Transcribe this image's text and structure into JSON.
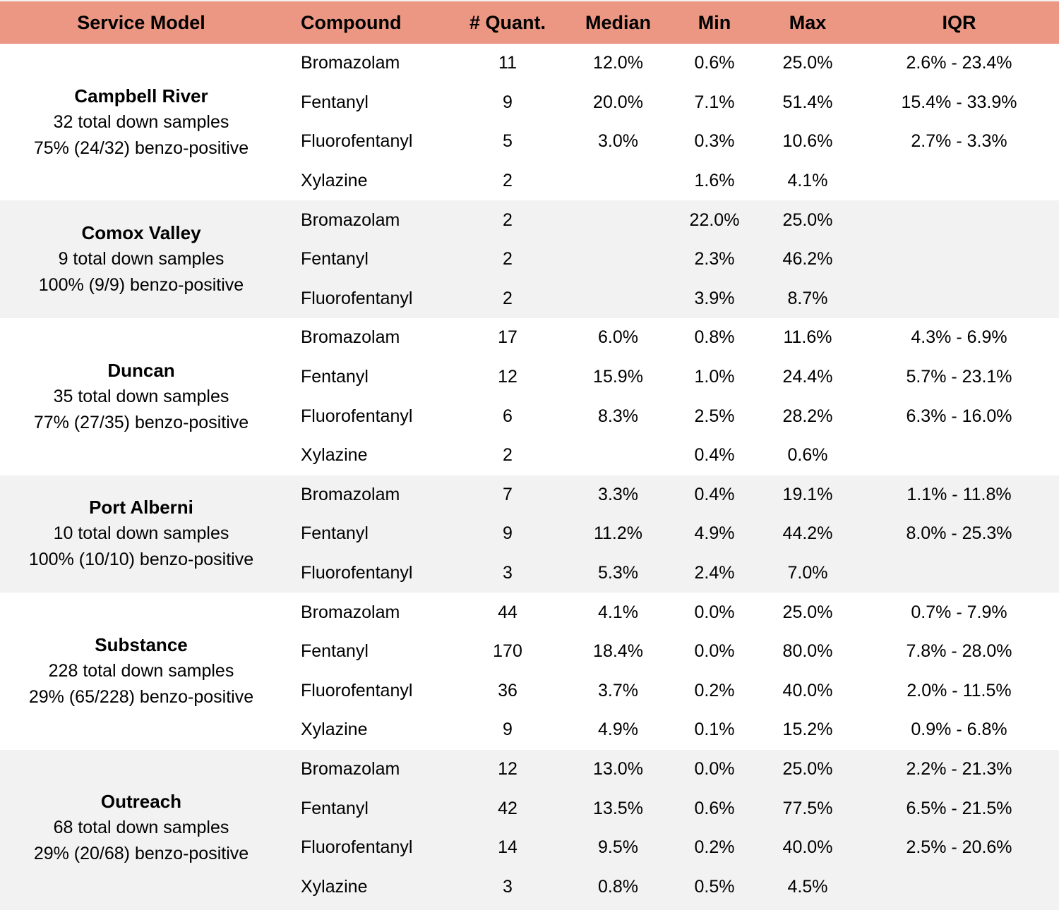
{
  "table": {
    "headers": [
      "Service Model",
      "Compound",
      "# Quant.",
      "Median",
      "Min",
      "Max",
      "IQR"
    ],
    "colors": {
      "header_bg": "#eb9783",
      "row_white": "#ffffff",
      "row_gray": "#f2f2f2"
    },
    "groups": [
      {
        "name": "Campbell River",
        "total": "32 total down samples",
        "benzo": "75% (24/32) benzo-positive",
        "rows": [
          {
            "compound": "Bromazolam",
            "quant": "11",
            "median": "12.0%",
            "min": "0.6%",
            "max": "25.0%",
            "iqr": "2.6% - 23.4%"
          },
          {
            "compound": "Fentanyl",
            "quant": "9",
            "median": "20.0%",
            "min": "7.1%",
            "max": "51.4%",
            "iqr": "15.4% - 33.9%"
          },
          {
            "compound": "Fluorofentanyl",
            "quant": "5",
            "median": "3.0%",
            "min": "0.3%",
            "max": "10.6%",
            "iqr": "2.7% - 3.3%"
          },
          {
            "compound": "Xylazine",
            "quant": "2",
            "median": "",
            "min": "1.6%",
            "max": "4.1%",
            "iqr": ""
          }
        ]
      },
      {
        "name": "Comox Valley",
        "total": "9 total down samples",
        "benzo": "100% (9/9) benzo-positive",
        "rows": [
          {
            "compound": "Bromazolam",
            "quant": "2",
            "median": "",
            "min": "22.0%",
            "max": "25.0%",
            "iqr": ""
          },
          {
            "compound": "Fentanyl",
            "quant": "2",
            "median": "",
            "min": "2.3%",
            "max": "46.2%",
            "iqr": ""
          },
          {
            "compound": "Fluorofentanyl",
            "quant": "2",
            "median": "",
            "min": "3.9%",
            "max": "8.7%",
            "iqr": ""
          }
        ]
      },
      {
        "name": "Duncan",
        "total": "35 total down samples",
        "benzo": "77% (27/35) benzo-positive",
        "rows": [
          {
            "compound": "Bromazolam",
            "quant": "17",
            "median": "6.0%",
            "min": "0.8%",
            "max": "11.6%",
            "iqr": "4.3% - 6.9%"
          },
          {
            "compound": "Fentanyl",
            "quant": "12",
            "median": "15.9%",
            "min": "1.0%",
            "max": "24.4%",
            "iqr": "5.7% - 23.1%"
          },
          {
            "compound": "Fluorofentanyl",
            "quant": "6",
            "median": "8.3%",
            "min": "2.5%",
            "max": "28.2%",
            "iqr": "6.3% - 16.0%"
          },
          {
            "compound": "Xylazine",
            "quant": "2",
            "median": "",
            "min": "0.4%",
            "max": "0.6%",
            "iqr": ""
          }
        ]
      },
      {
        "name": "Port Alberni",
        "total": "10 total down samples",
        "benzo": "100% (10/10) benzo-positive",
        "rows": [
          {
            "compound": "Bromazolam",
            "quant": "7",
            "median": "3.3%",
            "min": "0.4%",
            "max": "19.1%",
            "iqr": "1.1% - 11.8%"
          },
          {
            "compound": "Fentanyl",
            "quant": "9",
            "median": "11.2%",
            "min": "4.9%",
            "max": "44.2%",
            "iqr": "8.0% - 25.3%"
          },
          {
            "compound": "Fluorofentanyl",
            "quant": "3",
            "median": "5.3%",
            "min": "2.4%",
            "max": "7.0%",
            "iqr": ""
          }
        ]
      },
      {
        "name": "Substance",
        "total": "228 total down samples",
        "benzo": "29% (65/228) benzo-positive",
        "rows": [
          {
            "compound": "Bromazolam",
            "quant": "44",
            "median": "4.1%",
            "min": "0.0%",
            "max": "25.0%",
            "iqr": "0.7% - 7.9%"
          },
          {
            "compound": "Fentanyl",
            "quant": "170",
            "median": "18.4%",
            "min": "0.0%",
            "max": "80.0%",
            "iqr": "7.8% - 28.0%"
          },
          {
            "compound": "Fluorofentanyl",
            "quant": "36",
            "median": "3.7%",
            "min": "0.2%",
            "max": "40.0%",
            "iqr": "2.0% - 11.5%"
          },
          {
            "compound": "Xylazine",
            "quant": "9",
            "median": "4.9%",
            "min": "0.1%",
            "max": "15.2%",
            "iqr": "0.9% - 6.8%"
          }
        ]
      },
      {
        "name": "Outreach",
        "total": "68 total down samples",
        "benzo": "29% (20/68) benzo-positive",
        "rows": [
          {
            "compound": "Bromazolam",
            "quant": "12",
            "median": "13.0%",
            "min": "0.0%",
            "max": "25.0%",
            "iqr": "2.2% - 21.3%"
          },
          {
            "compound": "Fentanyl",
            "quant": "42",
            "median": "13.5%",
            "min": "0.6%",
            "max": "77.5%",
            "iqr": "6.5% - 21.5%"
          },
          {
            "compound": "Fluorofentanyl",
            "quant": "14",
            "median": "9.5%",
            "min": "0.2%",
            "max": "40.0%",
            "iqr": "2.5% - 20.6%"
          },
          {
            "compound": "Xylazine",
            "quant": "3",
            "median": "0.8%",
            "min": "0.5%",
            "max": "4.5%",
            "iqr": ""
          }
        ]
      }
    ]
  }
}
